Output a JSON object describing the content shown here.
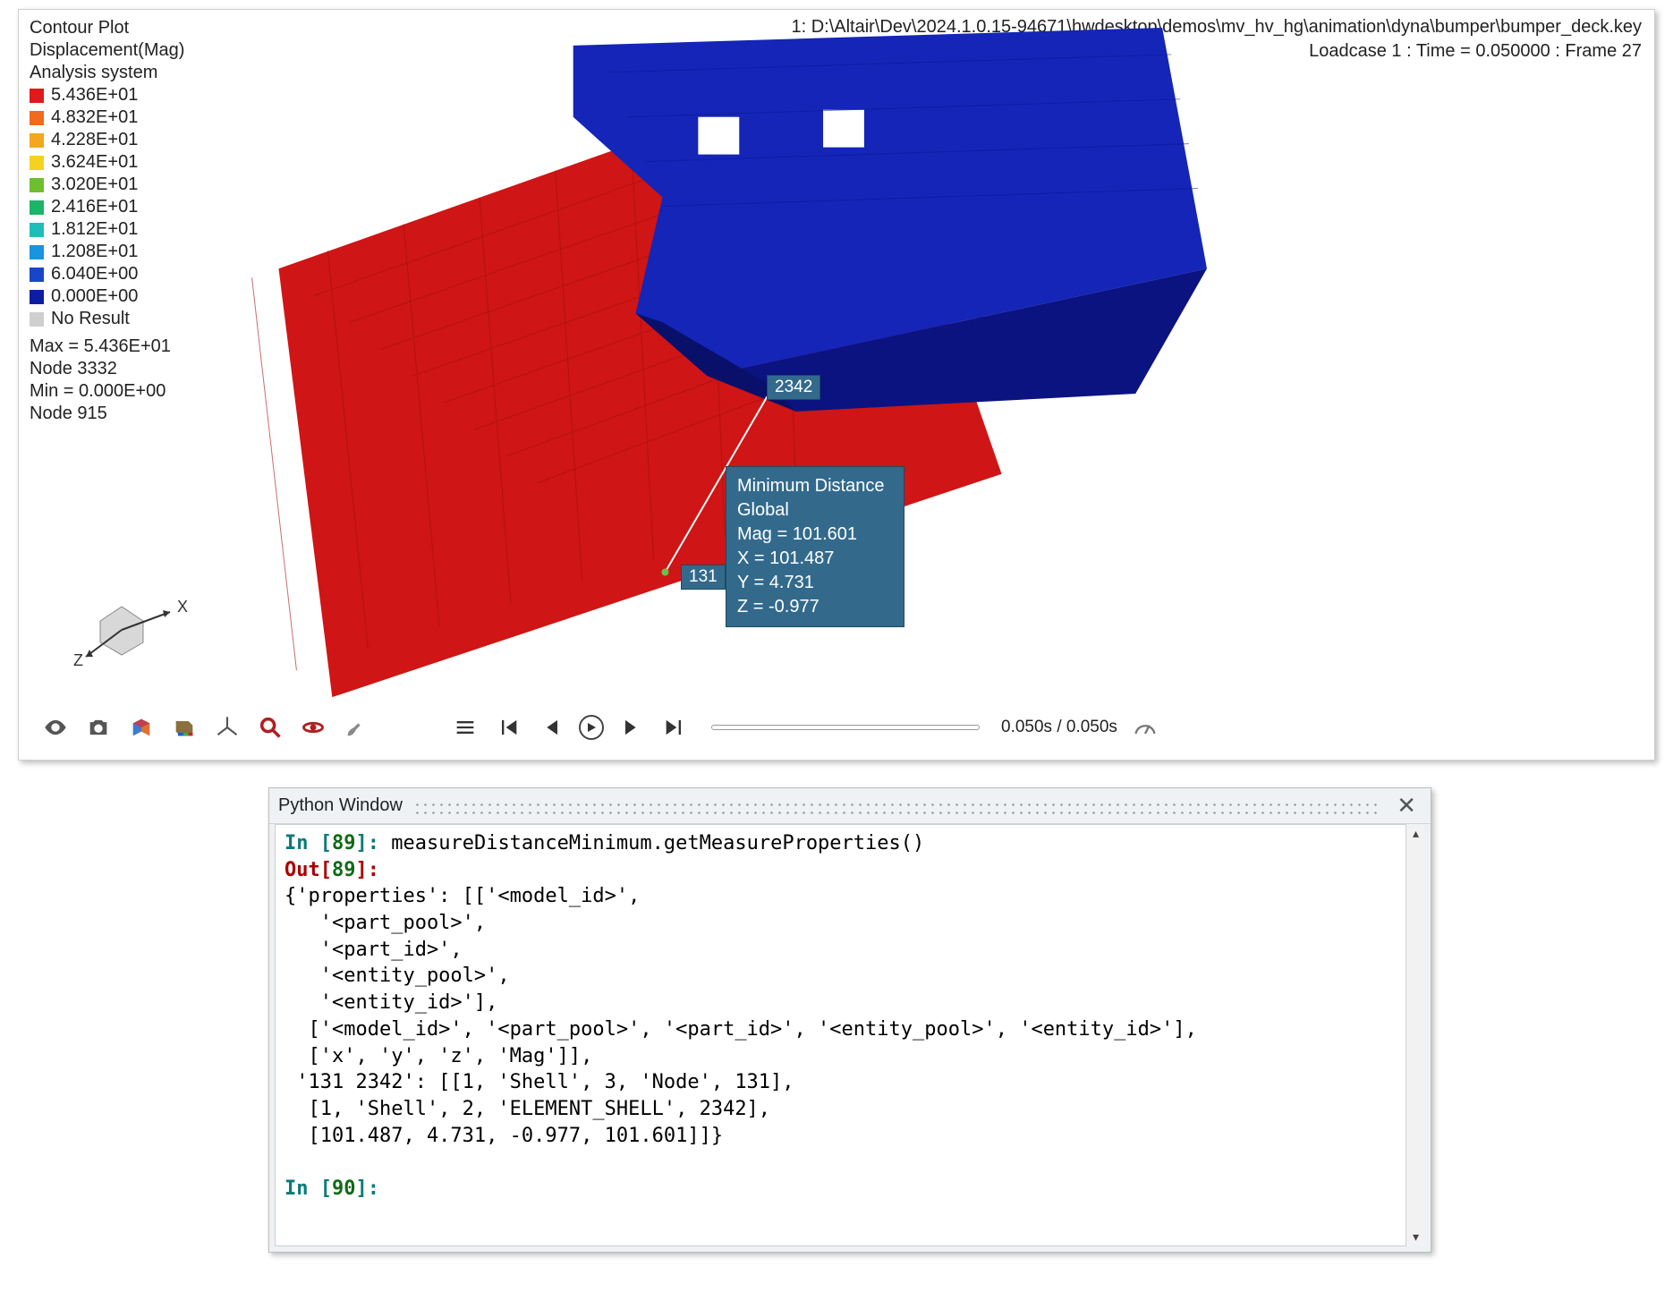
{
  "viewport": {
    "filepath": "1: D:\\Altair\\Dev\\2024.1.0.15-94671\\hwdesktop\\demos\\mv_hv_hg\\animation\\dyna\\bumper\\bumper_deck.key",
    "loadcase": "Loadcase 1 : Time = 0.050000 : Frame 27",
    "legend": {
      "title1": "Contour Plot",
      "title2": "Displacement(Mag)",
      "title3": "Analysis system",
      "rows": [
        {
          "color": "#e11919",
          "value": "5.436E+01"
        },
        {
          "color": "#f06a1f",
          "value": "4.832E+01"
        },
        {
          "color": "#f2a71e",
          "value": "4.228E+01"
        },
        {
          "color": "#f4d21f",
          "value": "3.624E+01"
        },
        {
          "color": "#6dc02c",
          "value": "3.020E+01"
        },
        {
          "color": "#1db46a",
          "value": "2.416E+01"
        },
        {
          "color": "#1cbeb7",
          "value": "1.812E+01"
        },
        {
          "color": "#1795df",
          "value": "1.208E+01"
        },
        {
          "color": "#1846c8",
          "value": "6.040E+00"
        },
        {
          "color": "#0b1ea0",
          "value": "0.000E+00"
        }
      ],
      "noResult": "No Result",
      "max": "Max =  5.436E+01",
      "maxNode": "Node 3332",
      "min": "Min =   0.000E+00",
      "minNode": "Node 915"
    },
    "nodeA": "2342",
    "nodeB": "131",
    "info": {
      "l1": "Minimum Distance",
      "l2": "Global",
      "l3": "Mag = 101.601",
      "l4": "X = 101.487",
      "l5": "Y = 4.731",
      "l6": "Z = -0.977"
    },
    "time": "0.050s / 0.050s",
    "axes": {
      "x": "X",
      "z": "Z"
    }
  },
  "python": {
    "title": "Python Window",
    "in1_pre": "In [",
    "in1_num": "89",
    "in1_post": "]: ",
    "in1_code": "measureDistanceMinimum.getMeasureProperties()",
    "out_pre": "Out[",
    "out_num": "89",
    "out_post": "]:",
    "body": "{'properties': [['<model_id>',\n   '<part_pool>',\n   '<part_id>',\n   '<entity_pool>',\n   '<entity_id>'],\n  ['<model_id>', '<part_pool>', '<part_id>', '<entity_pool>', '<entity_id>'],\n  ['x', 'y', 'z', 'Mag']],\n '131 2342': [[1, 'Shell', 3, 'Node', 131],\n  [1, 'Shell', 2, 'ELEMENT_SHELL', 2342],\n  [101.487, 4.731, -0.977, 101.601]]}",
    "in2_pre": "In [",
    "in2_num": "90",
    "in2_post": "]: "
  }
}
